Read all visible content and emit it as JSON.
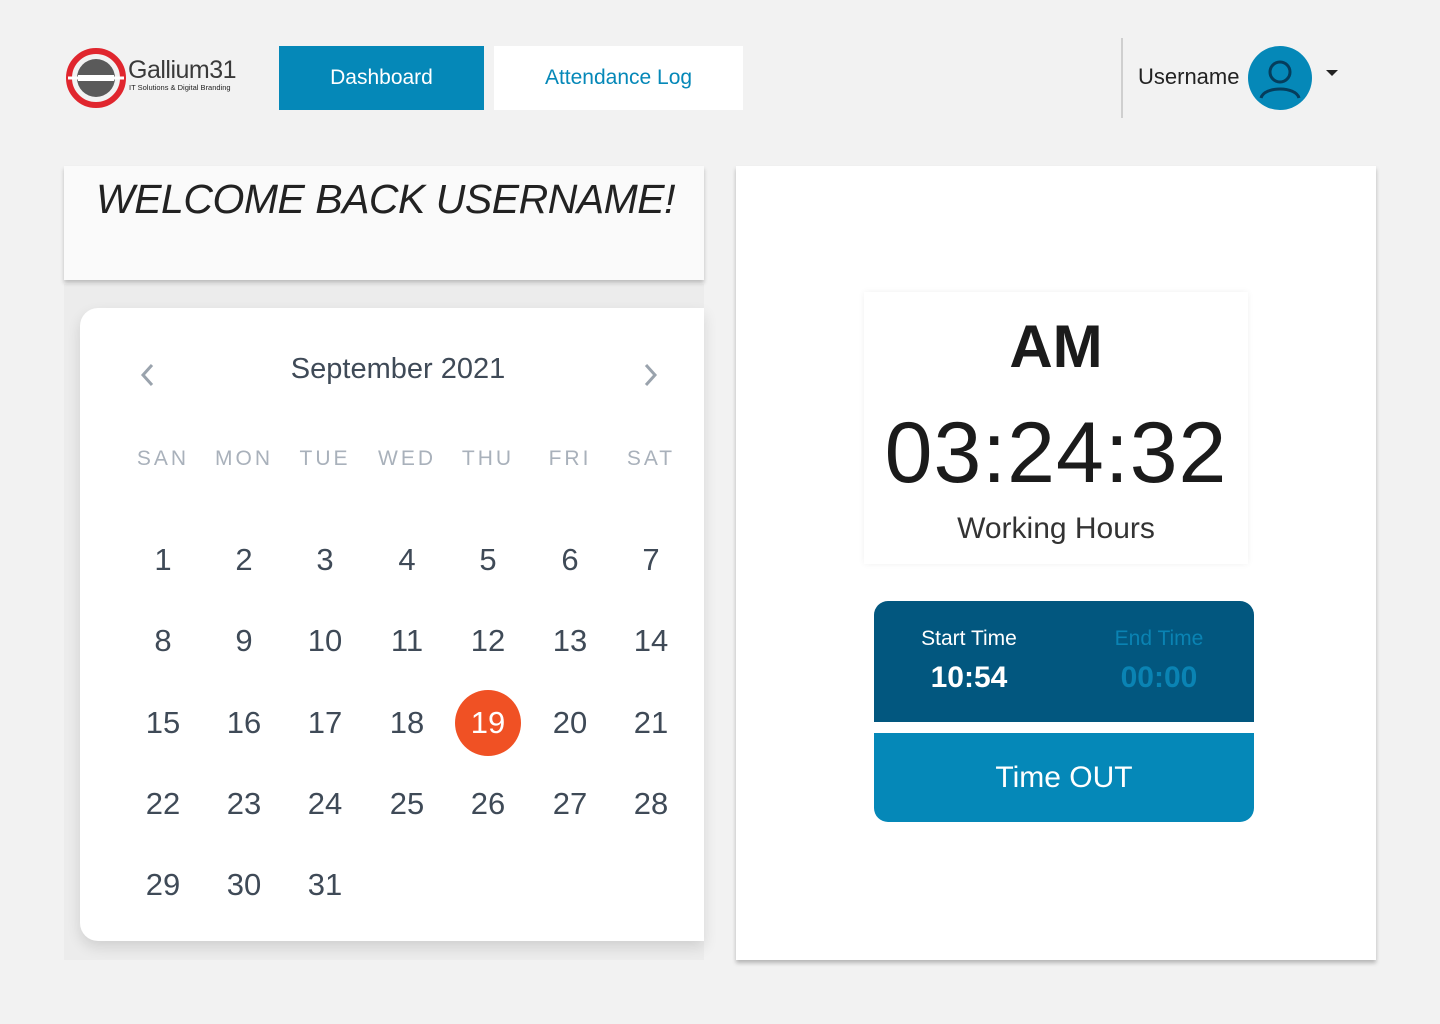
{
  "brand": {
    "name": "Gallium31",
    "tagline": "IT Solutions & Digital Branding",
    "colors": {
      "primary": "#0588b8",
      "dark": "#02577f",
      "accent": "#f05124",
      "logo_red": "#e0262e"
    }
  },
  "nav": {
    "dashboard_label": "Dashboard",
    "attendance_label": "Attendance Log",
    "active": "Dashboard"
  },
  "user": {
    "name": "Username",
    "avatar_icon": "user-icon",
    "menu_icon": "caret-down-icon"
  },
  "welcome": {
    "text": "WELCOME BACK USERNAME!"
  },
  "calendar": {
    "month_label": "September 2021",
    "prev_icon": "chevron-left-icon",
    "next_icon": "chevron-right-icon",
    "weekdays": [
      "SAN",
      "MON",
      "TUE",
      "WED",
      "THU",
      "FRI",
      "SAT"
    ],
    "weeks": [
      [
        "1",
        "2",
        "3",
        "4",
        "5",
        "6",
        "7"
      ],
      [
        "8",
        "9",
        "10",
        "11",
        "12",
        "13",
        "14"
      ],
      [
        "15",
        "16",
        "17",
        "18",
        "19",
        "20",
        "21"
      ],
      [
        "22",
        "23",
        "24",
        "25",
        "26",
        "27",
        "28"
      ],
      [
        "29",
        "30",
        "31",
        "",
        "",
        "",
        ""
      ]
    ],
    "selected_day": "19"
  },
  "clock": {
    "period": "AM",
    "time": "03:24:32",
    "caption": "Working Hours"
  },
  "shift": {
    "start_label": "Start Time",
    "start_value": "10:54",
    "end_label": "End Time",
    "end_value": "00:00"
  },
  "actions": {
    "timeout_label": "Time OUT"
  }
}
